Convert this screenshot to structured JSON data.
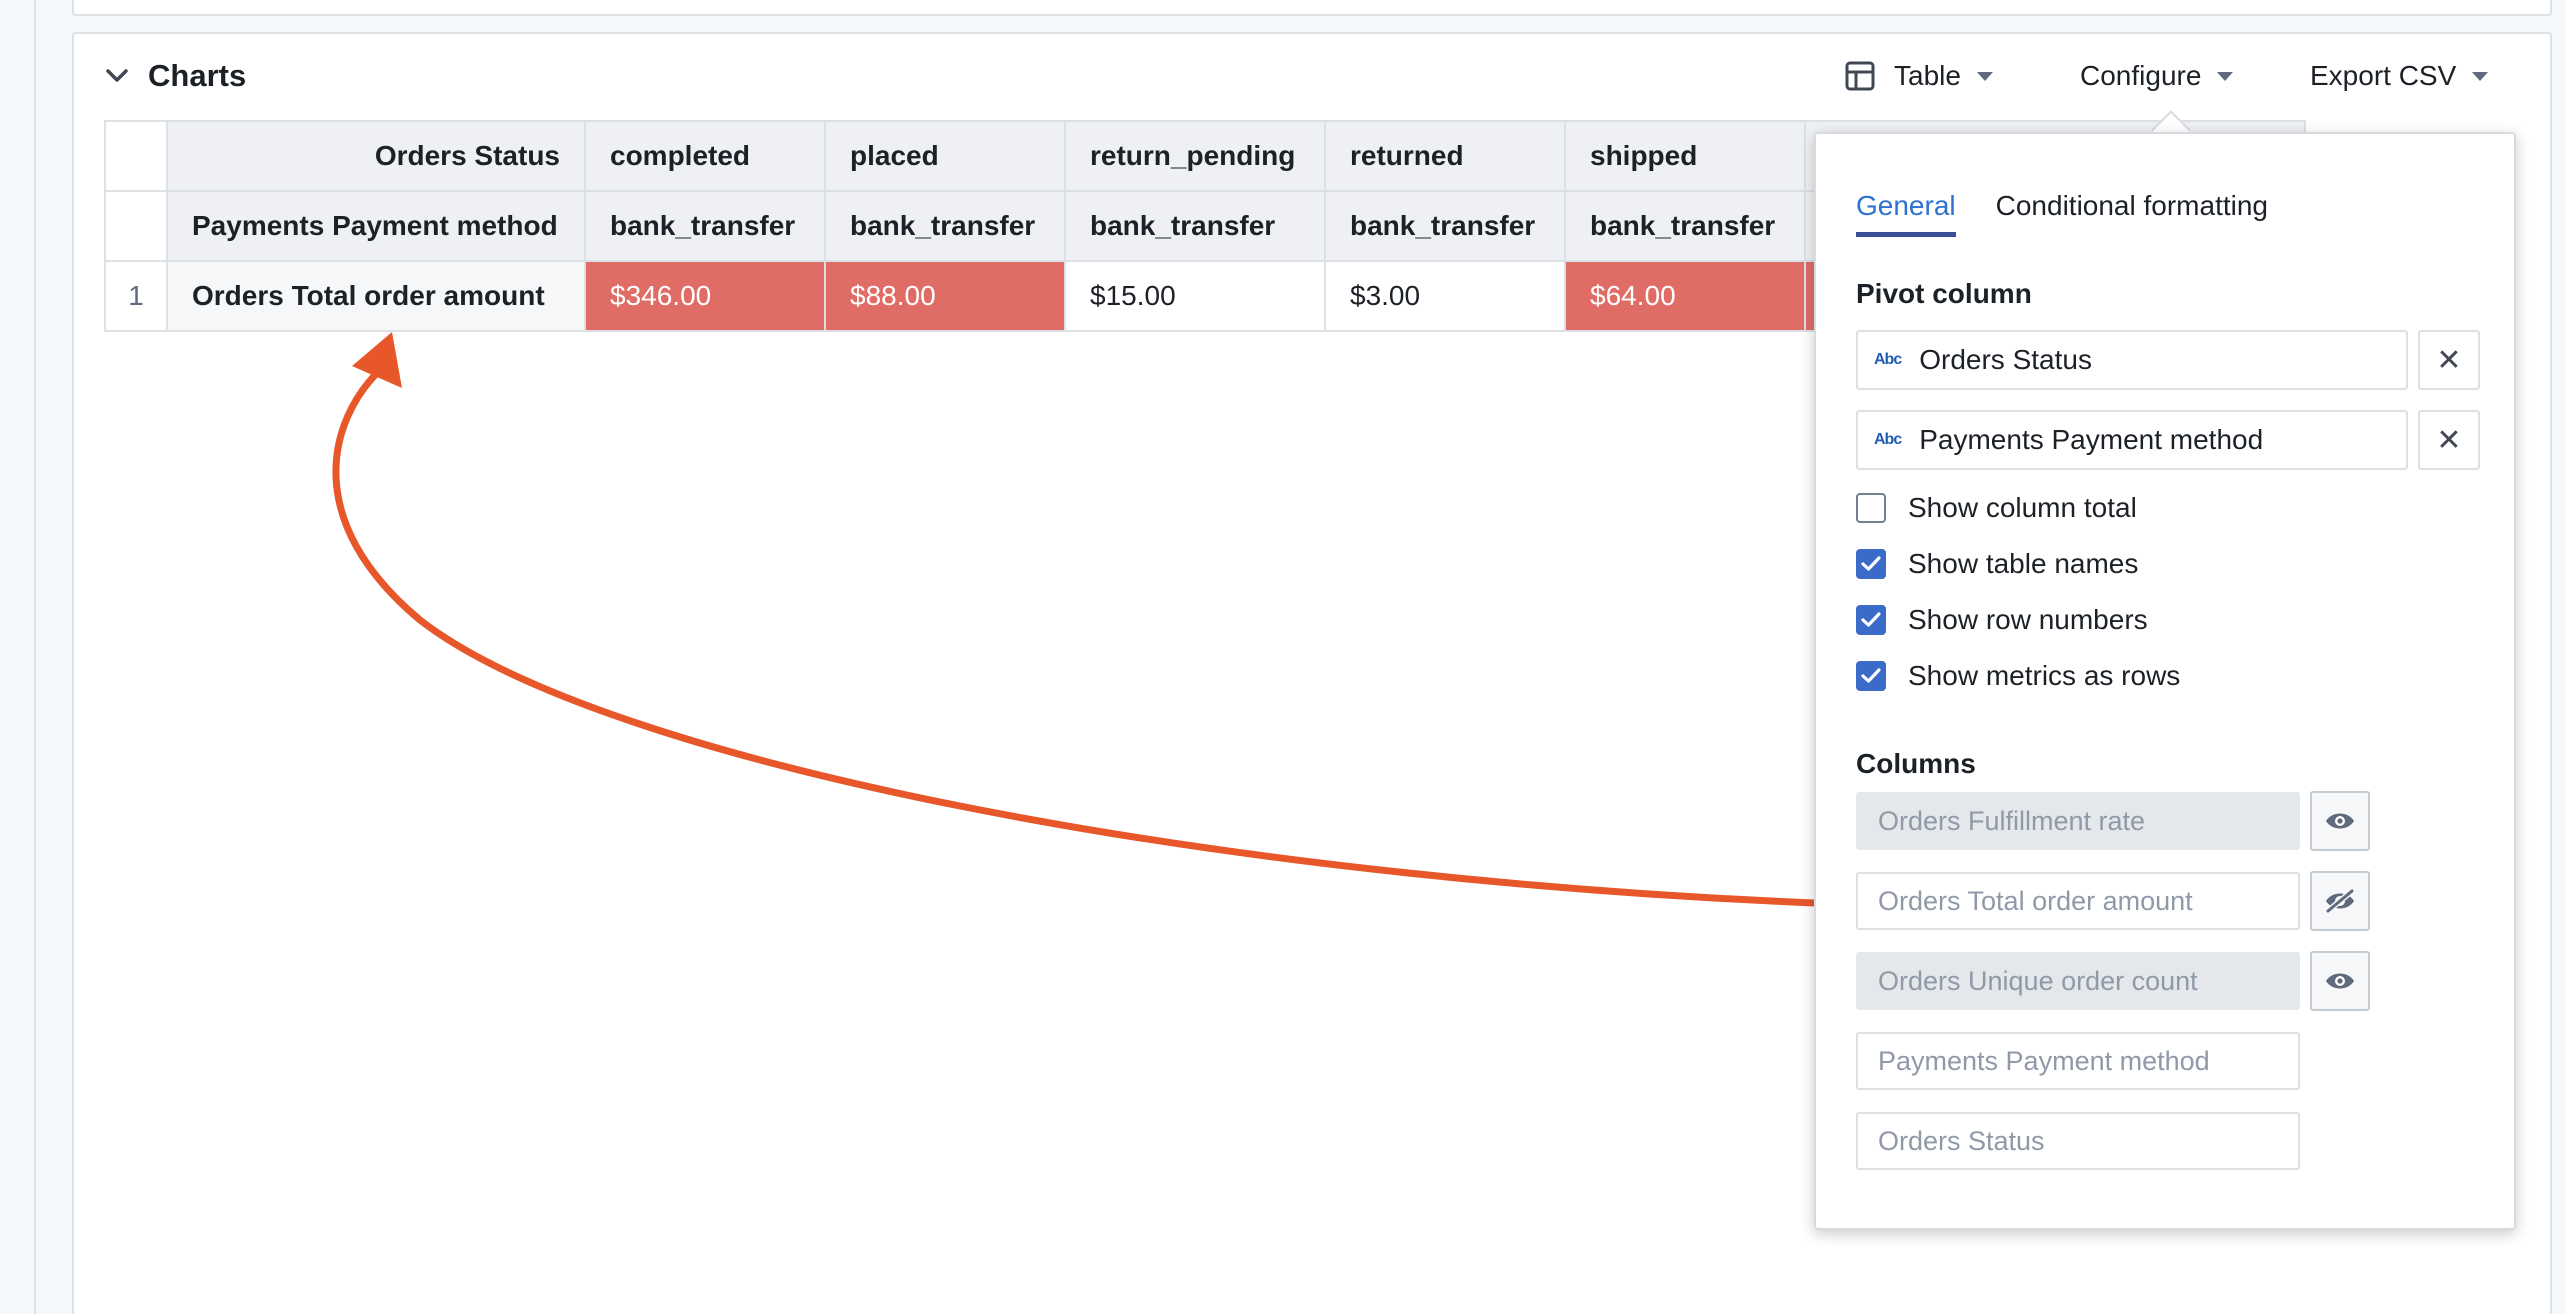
{
  "card": {
    "title": "Charts"
  },
  "toolbar": {
    "table_label": "Table",
    "configure_label": "Configure",
    "export_label": "Export CSV"
  },
  "table": {
    "header_rows": [
      {
        "label": "Orders Status",
        "cells": [
          "completed",
          "placed",
          "return_pending",
          "returned",
          "shipped"
        ]
      },
      {
        "label": "Payments Payment method",
        "cells": [
          "bank_transfer",
          "bank_transfer",
          "bank_transfer",
          "bank_transfer",
          "bank_transfer"
        ]
      }
    ],
    "rows": [
      {
        "num": "1",
        "label": "Orders Total order amount",
        "cells": [
          "$346.00",
          "$88.00",
          "$15.00",
          "$3.00",
          "$64.00"
        ],
        "highlight": [
          true,
          true,
          false,
          false,
          true
        ]
      }
    ],
    "highlight_color": "#e06c66"
  },
  "popover": {
    "tabs": [
      "General",
      "Conditional formatting"
    ],
    "active_tab": "General",
    "pivot_section": "Pivot column",
    "pivot_fields": [
      "Orders Status",
      "Payments Payment method"
    ],
    "pivot_type_icon": "Abc",
    "checkboxes": [
      {
        "label": "Show column total",
        "checked": false
      },
      {
        "label": "Show table names",
        "checked": true
      },
      {
        "label": "Show row numbers",
        "checked": true
      },
      {
        "label": "Show metrics as rows",
        "checked": true
      }
    ],
    "columns_section": "Columns",
    "columns": [
      {
        "name": "Orders Fulfillment rate",
        "visible": false,
        "has_toggle": true,
        "icon": "eye-icon"
      },
      {
        "name": "Orders Total order amount",
        "visible": true,
        "has_toggle": true,
        "icon": "eye-off-icon"
      },
      {
        "name": "Orders Unique order count",
        "visible": false,
        "has_toggle": true,
        "icon": "eye-icon"
      },
      {
        "name": "Payments Payment method",
        "visible": true,
        "has_toggle": false
      },
      {
        "name": "Orders Status",
        "visible": true,
        "has_toggle": false
      }
    ]
  },
  "annotation": {
    "arrow_color": "#e8572a"
  },
  "icons": {
    "collapse": "chevron-down-icon",
    "table": "table-icon",
    "remove": "close-icon"
  }
}
